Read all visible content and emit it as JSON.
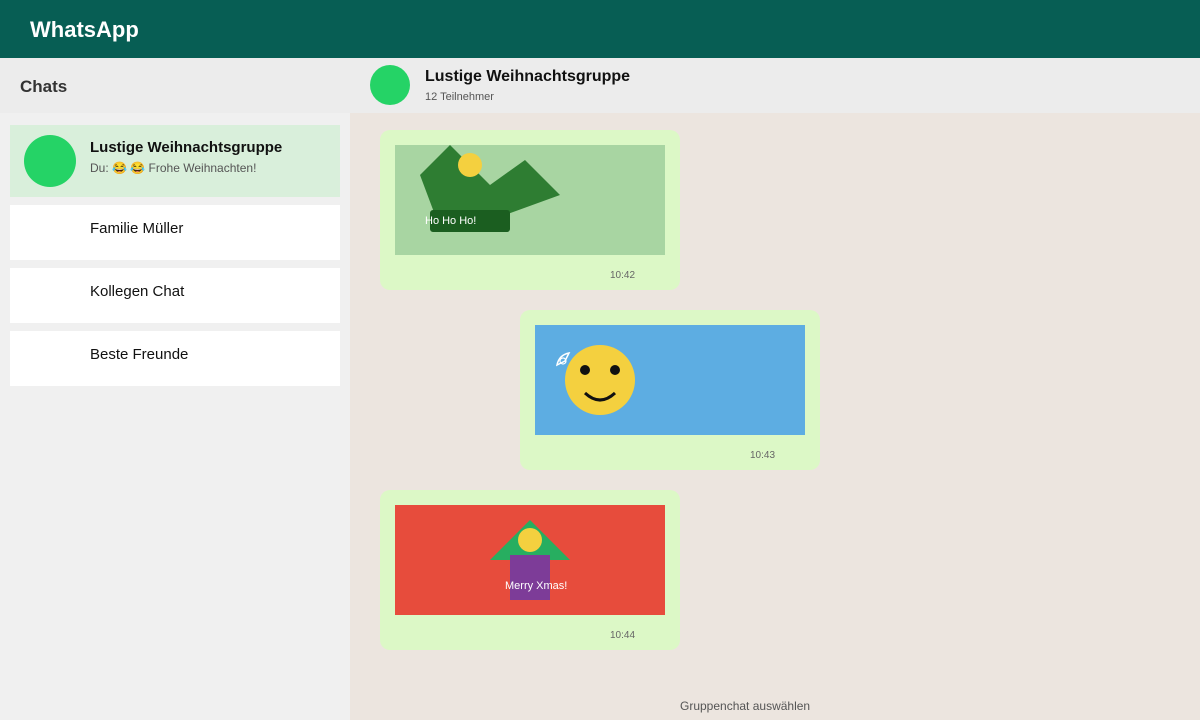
{
  "app": {
    "title": "WhatsApp"
  },
  "sidebar": {
    "title": "Chats",
    "chats": [
      {
        "name": "Lustige Weihnachtsgruppe",
        "preview": "Du: 😂 😂 Frohe Weihnachten!",
        "active": true
      },
      {
        "name": "Familie Müller"
      },
      {
        "name": "Kollegen Chat"
      },
      {
        "name": "Beste Freunde"
      }
    ]
  },
  "conversation": {
    "name": "Lustige Weihnachtsgruppe",
    "subtitle": "12 Teilnehmer",
    "messages": [
      {
        "sticker": "dinosaur-santa",
        "caption": "Ho Ho Ho!",
        "time": "10:42",
        "bg": "#a8d5a2"
      },
      {
        "sticker": "smiley-santa-hat",
        "time": "10:43",
        "bg": "#5dade2"
      },
      {
        "sticker": "gift-tree",
        "caption": "Merry Xmas!",
        "time": "10:44",
        "bg": "#e74c3c"
      }
    ]
  },
  "footer": {
    "hint": "Gruppenchat auswählen"
  },
  "colors": {
    "header": "#075e54",
    "accent": "#25d366",
    "bubble": "#dcf8c6",
    "chat_bg": "#ece5df"
  }
}
